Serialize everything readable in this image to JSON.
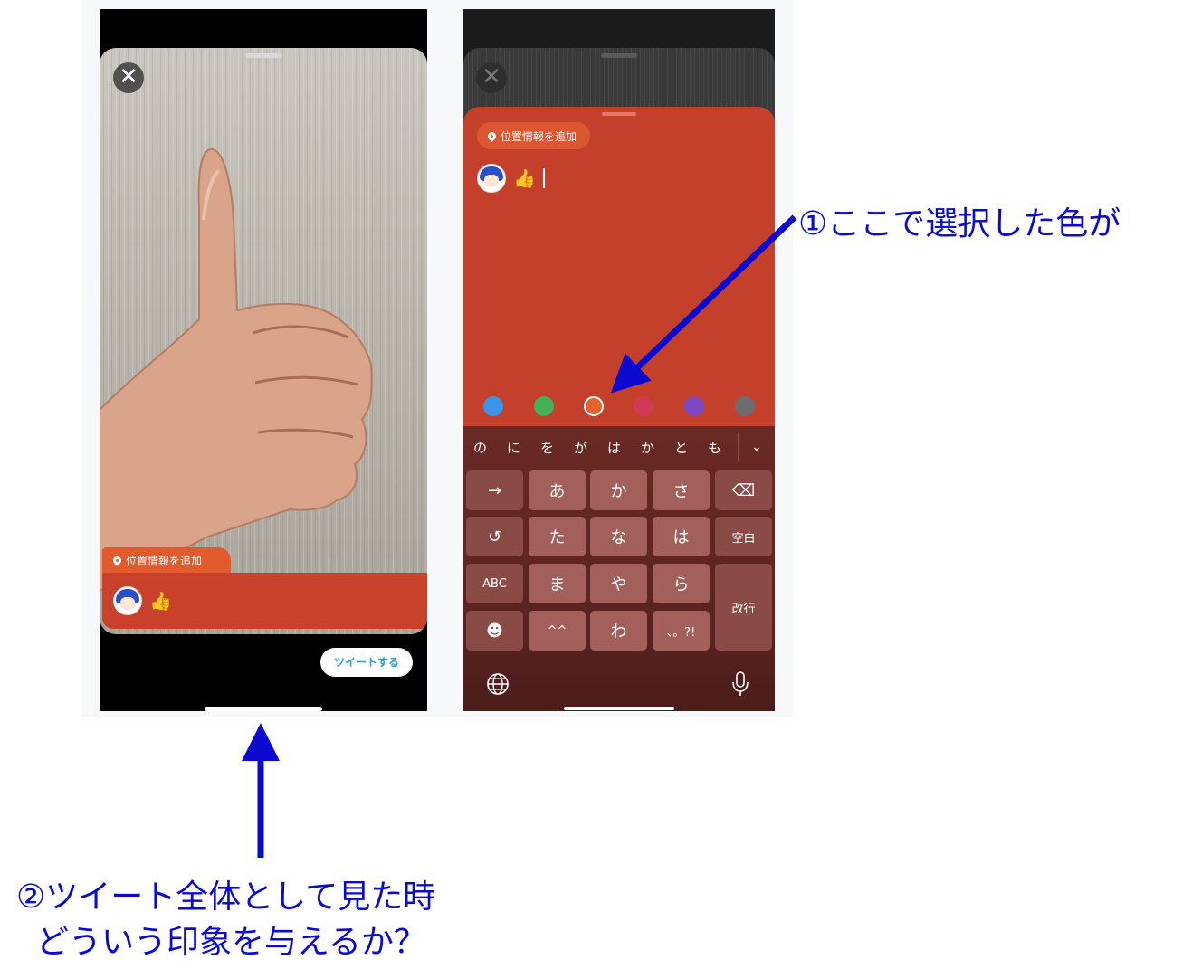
{
  "left_screen": {
    "close_symbol": "✕",
    "location_label": "位置情報を追加",
    "emoji": "👍",
    "tweet_button_label": "ツイートする"
  },
  "right_screen": {
    "close_symbol": "✕",
    "location_label": "位置情報を追加",
    "emoji": "👍",
    "sheet_color": "#c5402a",
    "color_swatches": [
      {
        "name": "blue",
        "color": "#3b94e6",
        "selected": false
      },
      {
        "name": "green",
        "color": "#44b05a",
        "selected": false
      },
      {
        "name": "orange",
        "color": "#e36230",
        "selected": true
      },
      {
        "name": "crimson",
        "color": "#d03a56",
        "selected": false
      },
      {
        "name": "purple",
        "color": "#7b48c4",
        "selected": false
      },
      {
        "name": "gray",
        "color": "#6c6d70",
        "selected": false
      }
    ],
    "keyboard": {
      "suggestions": [
        "の",
        "に",
        "を",
        "が",
        "は",
        "か",
        "と",
        "も"
      ],
      "chevron": "⌄",
      "keys": {
        "arrow": "→",
        "a": "あ",
        "ka": "か",
        "sa": "さ",
        "backspace": "⌫",
        "undo": "↺",
        "ta": "た",
        "na": "な",
        "ha": "は",
        "space": "空白",
        "abc": "ABC",
        "ma": "ま",
        "ya": "や",
        "ra": "ら",
        "enter": "改行",
        "emoji": "☻",
        "kaomoji": "^^",
        "wa": "わ",
        "punct": "、。?!"
      },
      "globe_icon": "globe-icon",
      "mic_icon": "mic-icon"
    }
  },
  "annotations": {
    "note1": "①ここで選択した色が",
    "note2_line1": "②ツイート全体として見た時",
    "note2_line2": "どういう印象を与えるか？",
    "color": "#0a0ad0"
  }
}
